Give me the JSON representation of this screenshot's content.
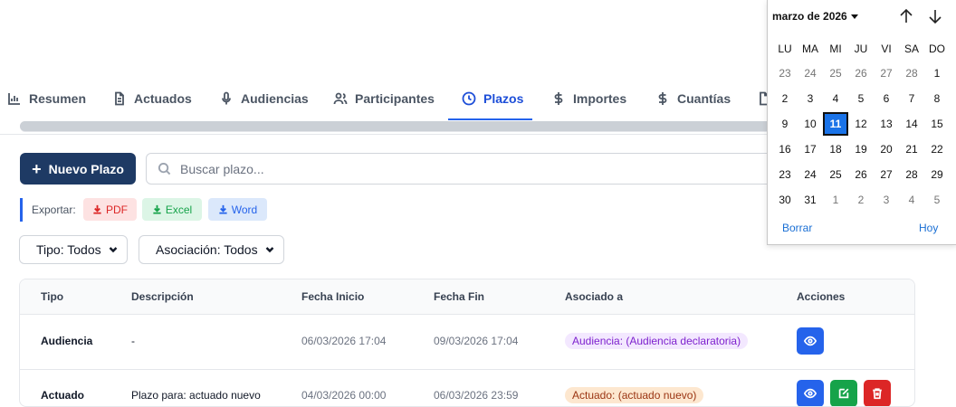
{
  "tabs": [
    {
      "label": "Resumen",
      "icon": "chart-icon"
    },
    {
      "label": "Actuados",
      "icon": "document-icon"
    },
    {
      "label": "Audiencias",
      "icon": "microphone-icon"
    },
    {
      "label": "Participantes",
      "icon": "users-icon"
    },
    {
      "label": "Plazos",
      "icon": "clock-icon",
      "active": true
    },
    {
      "label": "Importes",
      "icon": "dollar-icon"
    },
    {
      "label": "Cuantías",
      "icon": "dollar-icon"
    }
  ],
  "toolbar": {
    "new_label": "Nuevo Plazo",
    "search_placeholder": "Buscar plazo..."
  },
  "export": {
    "label": "Exportar:",
    "pdf": "PDF",
    "excel": "Excel",
    "word": "Word"
  },
  "filters": {
    "tipo": "Tipo: Todos",
    "asociacion": "Asociación: Todos"
  },
  "table": {
    "headers": [
      "Tipo",
      "Descripción",
      "Fecha Inicio",
      "Fecha Fin",
      "Asociado a",
      "Acciones"
    ],
    "rows": [
      {
        "tipo": "Audiencia",
        "descripcion": "-",
        "inicio": "06/03/2026 17:04",
        "fin": "09/03/2026 17:04",
        "asociado": "Audiencia: (Audiencia declaratoria)"
      },
      {
        "tipo": "Actuado",
        "descripcion": "Plazo para: actuado nuevo",
        "inicio": "04/03/2026 00:00",
        "fin": "06/03/2026 23:59",
        "asociado": "Actuado: (actuado nuevo)"
      }
    ]
  },
  "calendar": {
    "month": "marzo de 2026",
    "weekdays": [
      "LU",
      "MA",
      "MI",
      "JU",
      "VI",
      "SA",
      "DO"
    ],
    "weeks": [
      [
        "23",
        "24",
        "25",
        "26",
        "27",
        "28",
        "1"
      ],
      [
        "2",
        "3",
        "4",
        "5",
        "6",
        "7",
        "8"
      ],
      [
        "9",
        "10",
        "11",
        "12",
        "13",
        "14",
        "15"
      ],
      [
        "16",
        "17",
        "18",
        "19",
        "20",
        "21",
        "22"
      ],
      [
        "23",
        "24",
        "25",
        "26",
        "27",
        "28",
        "29"
      ],
      [
        "30",
        "31",
        "1",
        "2",
        "3",
        "4",
        "5"
      ]
    ],
    "selected_day": "11",
    "clear": "Borrar",
    "today": "Hoy"
  },
  "colors": {
    "primary": "#1e3a64",
    "active_tab": "#1d4ed8",
    "view": "#2563eb",
    "edit": "#16a34a",
    "delete": "#dc2626"
  }
}
